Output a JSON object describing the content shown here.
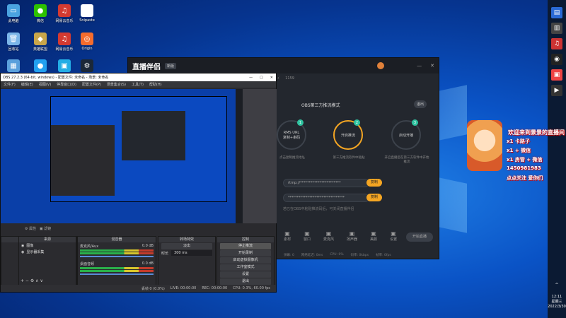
{
  "desktop_icons": [
    {
      "label": "此电脑",
      "color": "#4aa3e0",
      "glyph": "▭"
    },
    {
      "label": "微信",
      "color": "#2dc100",
      "glyph": "●"
    },
    {
      "label": "网易云音乐",
      "color": "#d33a31",
      "glyph": "♫"
    },
    {
      "label": "Snipaste",
      "color": "#ffffff",
      "glyph": "▤"
    },
    {
      "label": "回收站",
      "color": "#7bb6e8",
      "glyph": "🗑"
    },
    {
      "label": "英雄联盟",
      "color": "#c9a64a",
      "glyph": "◆"
    },
    {
      "label": "网易云音乐",
      "color": "#d33a31",
      "glyph": "♫"
    },
    {
      "label": "Origin",
      "color": "#f56c2d",
      "glyph": "◎"
    },
    {
      "label": "控制面板",
      "color": "#5aa0dc",
      "glyph": "▦"
    },
    {
      "label": "腾讯QQ",
      "color": "#22a0f0",
      "glyph": "●"
    },
    {
      "label": "哔哩哔哩",
      "color": "#23ade5",
      "glyph": "▣"
    },
    {
      "label": "Steam",
      "color": "#1b2838",
      "glyph": "⚙"
    }
  ],
  "livehime": {
    "app_name": "直播伴侣",
    "version": "新版",
    "room_id": "7628",
    "fans": "1159",
    "mode_title": "OBS第三方推流模式",
    "exit_label": "退出",
    "steps": [
      {
        "n": "1",
        "title": "RMS URL",
        "sub": "复制+串码"
      },
      {
        "n": "2",
        "title": "开启推流",
        "sub": ""
      },
      {
        "n": "3",
        "title": "启动开播",
        "sub": ""
      }
    ],
    "step_descriptions": [
      "点击复制推流地址",
      "第三方推流软件中粘贴",
      "开启直播后在第三方软件中开始推流"
    ],
    "url_value": "rtmp://***********************",
    "key_value": "********************************",
    "copy_label": "复制",
    "hint": "若已在OBS中粘贴推流码后，可关闭直播伴侣",
    "toolbar": [
      "素材",
      "窗口",
      "麦克风",
      "扬声器",
      "美颜",
      "设置"
    ],
    "start_button": "开始直播",
    "status": [
      "弹幕: 0",
      "网络延迟: 0ms",
      "CPU: 0%",
      "码率: 0kbps",
      "帧率: 0fps"
    ]
  },
  "obs": {
    "window_title": "OBS 27.2.3 (64-bit, windows) - 配置文件: 未命名 - 场景: 未命名",
    "menu": [
      "文件(F)",
      "编辑(E)",
      "视图(V)",
      "停靠窗口(D)",
      "配置文件(P)",
      "场景集合(S)",
      "工具(T)",
      "帮助(H)"
    ],
    "docks": {
      "scenes": "场景",
      "sources": "来源",
      "mixer": "混音器",
      "transitions": "转场特效",
      "controls": "控制"
    },
    "sources": [
      "图像",
      "显示器采集"
    ],
    "mixer_tracks": [
      {
        "name": "麦克风/Aux",
        "db": "0.0 dB"
      },
      {
        "name": "桌面音频",
        "db": "0.0 dB"
      }
    ],
    "transition": {
      "type": "淡出",
      "duration_label": "时长",
      "duration": "300 ms"
    },
    "controls": [
      "停止推流",
      "开始录制",
      "启动虚拟摄像机",
      "工作室模式",
      "设置",
      "退出"
    ],
    "status": {
      "dropped": "丢帧 0 (0.0%)",
      "live": "LIVE: 00:00:00",
      "rec": "REC: 00:00:00",
      "cpu": "CPU: 0.3%, 60.00 fps"
    }
  },
  "overlay_lines": [
    "欢迎来到景景的直播间",
    "x1 卡路子",
    "x1 + 微信",
    "x1 房管 + 微信",
    "1450981983",
    "点点关注 爱你们"
  ],
  "clock": {
    "time": "12:11",
    "weekday": "星期三",
    "date": "2022/3/30"
  }
}
